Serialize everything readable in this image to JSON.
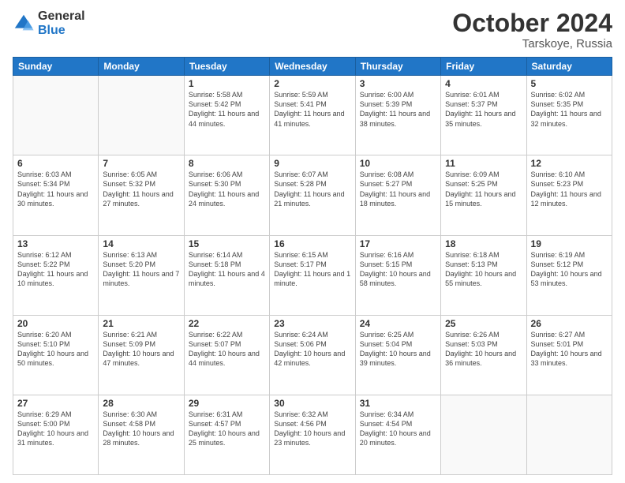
{
  "logo": {
    "general": "General",
    "blue": "Blue"
  },
  "header": {
    "month": "October 2024",
    "location": "Tarskoye, Russia"
  },
  "weekdays": [
    "Sunday",
    "Monday",
    "Tuesday",
    "Wednesday",
    "Thursday",
    "Friday",
    "Saturday"
  ],
  "weeks": [
    [
      {
        "day": "",
        "sunrise": "",
        "sunset": "",
        "daylight": ""
      },
      {
        "day": "",
        "sunrise": "",
        "sunset": "",
        "daylight": ""
      },
      {
        "day": "1",
        "sunrise": "Sunrise: 5:58 AM",
        "sunset": "Sunset: 5:42 PM",
        "daylight": "Daylight: 11 hours and 44 minutes."
      },
      {
        "day": "2",
        "sunrise": "Sunrise: 5:59 AM",
        "sunset": "Sunset: 5:41 PM",
        "daylight": "Daylight: 11 hours and 41 minutes."
      },
      {
        "day": "3",
        "sunrise": "Sunrise: 6:00 AM",
        "sunset": "Sunset: 5:39 PM",
        "daylight": "Daylight: 11 hours and 38 minutes."
      },
      {
        "day": "4",
        "sunrise": "Sunrise: 6:01 AM",
        "sunset": "Sunset: 5:37 PM",
        "daylight": "Daylight: 11 hours and 35 minutes."
      },
      {
        "day": "5",
        "sunrise": "Sunrise: 6:02 AM",
        "sunset": "Sunset: 5:35 PM",
        "daylight": "Daylight: 11 hours and 32 minutes."
      }
    ],
    [
      {
        "day": "6",
        "sunrise": "Sunrise: 6:03 AM",
        "sunset": "Sunset: 5:34 PM",
        "daylight": "Daylight: 11 hours and 30 minutes."
      },
      {
        "day": "7",
        "sunrise": "Sunrise: 6:05 AM",
        "sunset": "Sunset: 5:32 PM",
        "daylight": "Daylight: 11 hours and 27 minutes."
      },
      {
        "day": "8",
        "sunrise": "Sunrise: 6:06 AM",
        "sunset": "Sunset: 5:30 PM",
        "daylight": "Daylight: 11 hours and 24 minutes."
      },
      {
        "day": "9",
        "sunrise": "Sunrise: 6:07 AM",
        "sunset": "Sunset: 5:28 PM",
        "daylight": "Daylight: 11 hours and 21 minutes."
      },
      {
        "day": "10",
        "sunrise": "Sunrise: 6:08 AM",
        "sunset": "Sunset: 5:27 PM",
        "daylight": "Daylight: 11 hours and 18 minutes."
      },
      {
        "day": "11",
        "sunrise": "Sunrise: 6:09 AM",
        "sunset": "Sunset: 5:25 PM",
        "daylight": "Daylight: 11 hours and 15 minutes."
      },
      {
        "day": "12",
        "sunrise": "Sunrise: 6:10 AM",
        "sunset": "Sunset: 5:23 PM",
        "daylight": "Daylight: 11 hours and 12 minutes."
      }
    ],
    [
      {
        "day": "13",
        "sunrise": "Sunrise: 6:12 AM",
        "sunset": "Sunset: 5:22 PM",
        "daylight": "Daylight: 11 hours and 10 minutes."
      },
      {
        "day": "14",
        "sunrise": "Sunrise: 6:13 AM",
        "sunset": "Sunset: 5:20 PM",
        "daylight": "Daylight: 11 hours and 7 minutes."
      },
      {
        "day": "15",
        "sunrise": "Sunrise: 6:14 AM",
        "sunset": "Sunset: 5:18 PM",
        "daylight": "Daylight: 11 hours and 4 minutes."
      },
      {
        "day": "16",
        "sunrise": "Sunrise: 6:15 AM",
        "sunset": "Sunset: 5:17 PM",
        "daylight": "Daylight: 11 hours and 1 minute."
      },
      {
        "day": "17",
        "sunrise": "Sunrise: 6:16 AM",
        "sunset": "Sunset: 5:15 PM",
        "daylight": "Daylight: 10 hours and 58 minutes."
      },
      {
        "day": "18",
        "sunrise": "Sunrise: 6:18 AM",
        "sunset": "Sunset: 5:13 PM",
        "daylight": "Daylight: 10 hours and 55 minutes."
      },
      {
        "day": "19",
        "sunrise": "Sunrise: 6:19 AM",
        "sunset": "Sunset: 5:12 PM",
        "daylight": "Daylight: 10 hours and 53 minutes."
      }
    ],
    [
      {
        "day": "20",
        "sunrise": "Sunrise: 6:20 AM",
        "sunset": "Sunset: 5:10 PM",
        "daylight": "Daylight: 10 hours and 50 minutes."
      },
      {
        "day": "21",
        "sunrise": "Sunrise: 6:21 AM",
        "sunset": "Sunset: 5:09 PM",
        "daylight": "Daylight: 10 hours and 47 minutes."
      },
      {
        "day": "22",
        "sunrise": "Sunrise: 6:22 AM",
        "sunset": "Sunset: 5:07 PM",
        "daylight": "Daylight: 10 hours and 44 minutes."
      },
      {
        "day": "23",
        "sunrise": "Sunrise: 6:24 AM",
        "sunset": "Sunset: 5:06 PM",
        "daylight": "Daylight: 10 hours and 42 minutes."
      },
      {
        "day": "24",
        "sunrise": "Sunrise: 6:25 AM",
        "sunset": "Sunset: 5:04 PM",
        "daylight": "Daylight: 10 hours and 39 minutes."
      },
      {
        "day": "25",
        "sunrise": "Sunrise: 6:26 AM",
        "sunset": "Sunset: 5:03 PM",
        "daylight": "Daylight: 10 hours and 36 minutes."
      },
      {
        "day": "26",
        "sunrise": "Sunrise: 6:27 AM",
        "sunset": "Sunset: 5:01 PM",
        "daylight": "Daylight: 10 hours and 33 minutes."
      }
    ],
    [
      {
        "day": "27",
        "sunrise": "Sunrise: 6:29 AM",
        "sunset": "Sunset: 5:00 PM",
        "daylight": "Daylight: 10 hours and 31 minutes."
      },
      {
        "day": "28",
        "sunrise": "Sunrise: 6:30 AM",
        "sunset": "Sunset: 4:58 PM",
        "daylight": "Daylight: 10 hours and 28 minutes."
      },
      {
        "day": "29",
        "sunrise": "Sunrise: 6:31 AM",
        "sunset": "Sunset: 4:57 PM",
        "daylight": "Daylight: 10 hours and 25 minutes."
      },
      {
        "day": "30",
        "sunrise": "Sunrise: 6:32 AM",
        "sunset": "Sunset: 4:56 PM",
        "daylight": "Daylight: 10 hours and 23 minutes."
      },
      {
        "day": "31",
        "sunrise": "Sunrise: 6:34 AM",
        "sunset": "Sunset: 4:54 PM",
        "daylight": "Daylight: 10 hours and 20 minutes."
      },
      {
        "day": "",
        "sunrise": "",
        "sunset": "",
        "daylight": ""
      },
      {
        "day": "",
        "sunrise": "",
        "sunset": "",
        "daylight": ""
      }
    ]
  ]
}
